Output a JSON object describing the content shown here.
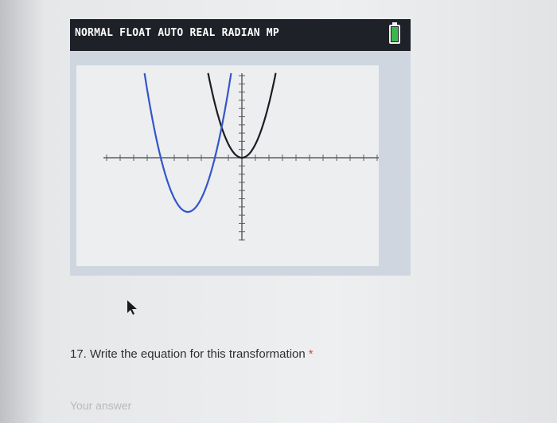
{
  "calculator": {
    "status_text": "NORMAL FLOAT AUTO REAL RADIAN MP",
    "battery_icon": "battery-full-icon",
    "status_bg": "#1f2128",
    "graph": {
      "x_window": [
        -10,
        10
      ],
      "y_window": [
        -10,
        10
      ],
      "axis_ticks": "integer",
      "curves": [
        {
          "color": "#1c1c24",
          "equation_shape": "y = x^2",
          "vertex": [
            0,
            0
          ]
        },
        {
          "color": "#3355cc",
          "equation_shape": "y = (x + 4)^2 - 4",
          "vertex": [
            -4,
            -4
          ]
        }
      ]
    }
  },
  "question": {
    "text": "17. Write the equation for this transformation",
    "required_mark": "*"
  },
  "answer": {
    "placeholder": "Your answer",
    "value": ""
  },
  "cursor_icon": "mouse-pointer-icon"
}
